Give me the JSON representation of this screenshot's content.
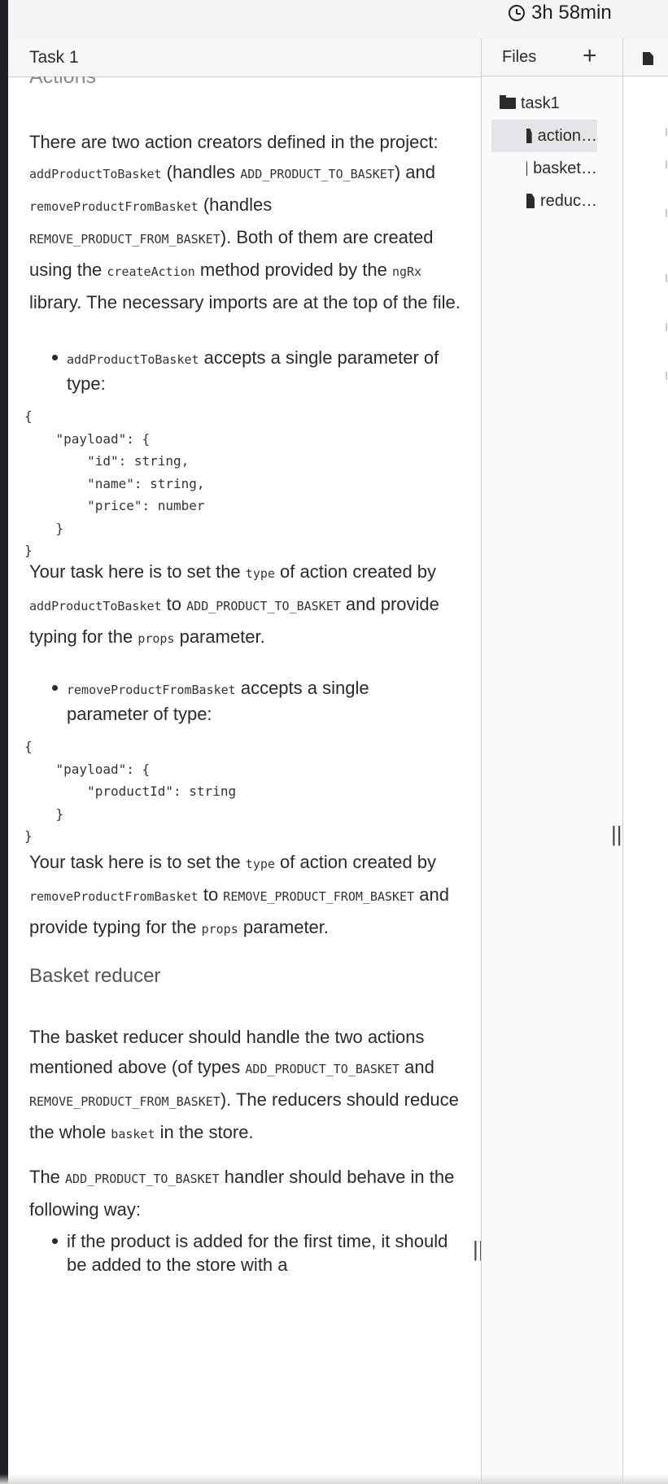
{
  "timer": {
    "value": "3h 58min"
  },
  "task": {
    "title": "Task 1",
    "cut_heading": "Actions",
    "intro": [
      {
        "t": "There are two action creators defined in the project: "
      },
      {
        "c": "addProductToBasket"
      },
      {
        "t": " (handles "
      },
      {
        "c": "ADD_PRODUCT_TO_BASKET"
      },
      {
        "t": ") and "
      },
      {
        "c": "removeProductFromBasket"
      },
      {
        "t": " (handles "
      },
      {
        "c": "REMOVE_PRODUCT_FROM_BASKET"
      },
      {
        "t": "). Both of them are created using the "
      },
      {
        "c": "createAction"
      },
      {
        "t": " method provided by the "
      },
      {
        "c": "ngRx"
      },
      {
        "t": " library. The necessary imports are at the top of the file."
      }
    ],
    "bullet1": [
      {
        "c": "addProductToBasket"
      },
      {
        "t": " accepts a single parameter of type:"
      }
    ],
    "code1": "{\n    \"payload\": {\n        \"id\": string,\n        \"name\": string,\n        \"price\": number\n    }\n}",
    "para2": [
      {
        "t": "Your task here is to set the "
      },
      {
        "c": "type"
      },
      {
        "t": " of action created by "
      },
      {
        "c": "addProductToBasket"
      },
      {
        "t": " to "
      },
      {
        "c": "ADD_PRODUCT_TO_BASKET"
      },
      {
        "t": " and provide typing for the "
      },
      {
        "c": "props"
      },
      {
        "t": " parameter."
      }
    ],
    "bullet2": [
      {
        "c": "removeProductFromBasket"
      },
      {
        "t": " accepts a single parameter of type:"
      }
    ],
    "code2": "{\n    \"payload\": {\n        \"productId\": string\n    }\n}",
    "para3": [
      {
        "t": "Your task here is to set the "
      },
      {
        "c": "type"
      },
      {
        "t": " of action created by "
      },
      {
        "c": "removeProductFromBasket"
      },
      {
        "t": " to "
      },
      {
        "c": "REMOVE_PRODUCT_FROM_BASKET"
      },
      {
        "t": " and provide typing for the "
      },
      {
        "c": "props"
      },
      {
        "t": " parameter."
      }
    ],
    "subheading": "Basket reducer",
    "para4": [
      {
        "t": "The basket reducer should handle the two actions mentioned above (of types "
      },
      {
        "c": "ADD_PRODUCT_TO_BASKET"
      },
      {
        "t": " and "
      },
      {
        "c": "REMOVE_PRODUCT_FROM_BASKET"
      },
      {
        "t": "). The reducers should reduce the whole "
      },
      {
        "c": "basket"
      },
      {
        "t": " in the store."
      }
    ],
    "para5": [
      {
        "t": "The "
      },
      {
        "c": "ADD_PRODUCT_TO_BASKET"
      },
      {
        "t": " handler should behave in the following way:"
      }
    ],
    "bullet3": [
      {
        "t": "if the product is added for the first time, it should be added to the store with a"
      }
    ]
  },
  "files": {
    "title": "Files",
    "add": "+",
    "root": "task1",
    "items": [
      "action…",
      "basket…",
      "reduc…"
    ]
  },
  "handles": {
    "glyph": "||"
  }
}
